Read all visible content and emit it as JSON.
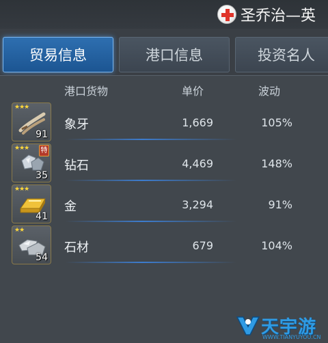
{
  "header": {
    "port_name": "圣乔治—英"
  },
  "tabs": [
    {
      "label": "贸易信息",
      "active": true
    },
    {
      "label": "港口信息",
      "active": false
    },
    {
      "label": "投资名人",
      "active": false
    }
  ],
  "table": {
    "headers": {
      "goods": "港口货物",
      "price": "单价",
      "fluctuation": "波动"
    },
    "rows": [
      {
        "name": "象牙",
        "price": "1,669",
        "fluctuation": "105%",
        "qty": "91",
        "stars": "★★★",
        "special": "",
        "icon": "ivory-icon"
      },
      {
        "name": "钻石",
        "price": "4,469",
        "fluctuation": "148%",
        "qty": "35",
        "stars": "★★★",
        "special": "特",
        "icon": "diamond-icon"
      },
      {
        "name": "金",
        "price": "3,294",
        "fluctuation": "91%",
        "qty": "41",
        "stars": "★★★",
        "special": "",
        "icon": "gold-bar-icon"
      },
      {
        "name": "石材",
        "price": "679",
        "fluctuation": "104%",
        "qty": "54",
        "stars": "★★",
        "special": "",
        "icon": "stone-icon"
      }
    ]
  },
  "watermark": {
    "text": "天宇游",
    "url": "WWW.TIANYUYOU.CN"
  },
  "colors": {
    "active_tab": "#1c5592",
    "star": "#ffd83a",
    "watermark": "#2f9be4"
  }
}
